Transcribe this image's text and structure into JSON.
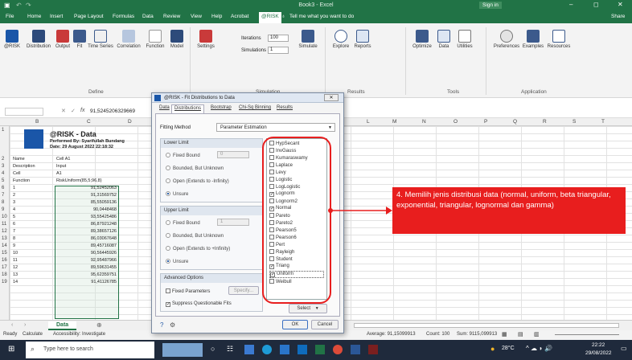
{
  "window": {
    "title": "Book3 - Excel",
    "sign_in": "Sign in",
    "share": "Share"
  },
  "menu": [
    "File",
    "Home",
    "Insert",
    "Page Layout",
    "Formulas",
    "Data",
    "Review",
    "View",
    "Help",
    "Acrobat",
    "@RISK"
  ],
  "tell_me": "Tell me what you want to do",
  "ribbon": {
    "buttons": [
      "@RISK",
      "Distribution",
      "Output",
      "Fit",
      "Time Series",
      "Correlation",
      "Function",
      "Model",
      "Settings",
      "Simulate",
      "Explore",
      "Reports",
      "Optimize",
      "Data",
      "Utilities",
      "Preferences",
      "Examples",
      "Resources"
    ],
    "iterations_label": "Iterations",
    "iterations_value": "100",
    "simulations_label": "Simulations",
    "simulations_value": "1",
    "groups": [
      "Define",
      "Simulation",
      "Results",
      "Tools",
      "Application"
    ]
  },
  "formula_bar": {
    "value": "91,5245206329669"
  },
  "columns": [
    "B",
    "C",
    "D",
    "L",
    "M",
    "N",
    "O",
    "P",
    "Q",
    "R",
    "S",
    "T"
  ],
  "rows": [
    "1",
    "2",
    "3",
    "4",
    "5",
    "6",
    "7",
    "8",
    "9",
    "10",
    "11",
    "12",
    "13",
    "14",
    "15",
    "16",
    "17",
    "18",
    "19"
  ],
  "report": {
    "title": "@RISK - Data",
    "performed_by": "Performed By: Syarifullah Bundang",
    "date": "Date: 29 August 2022 22:18:32",
    "rows": [
      {
        "label": "Name",
        "value": "Cell A1"
      },
      {
        "label": "Description",
        "value": "Input"
      },
      {
        "label": "Cell",
        "value": "A1"
      },
      {
        "label": "Function",
        "value": "RiskUniform(85,5;96,8)"
      }
    ],
    "index": [
      "1",
      "2",
      "3",
      "4",
      "5",
      "6",
      "7",
      "8",
      "9",
      "10",
      "11",
      "12",
      "13",
      "14"
    ],
    "values": [
      "91,52452063",
      "91,31569752",
      "85,55059136",
      "90,0448468",
      "93,55425486",
      "86,87921248",
      "89,38657126",
      "86,03067648",
      "89,45716087",
      "90,56445926",
      "92,95487966",
      "89,59631455",
      "95,62359751",
      "91,41126785"
    ]
  },
  "dialog": {
    "title": "@RISK - Fit Distributions to Data",
    "tabs": [
      "Data",
      "Distributions",
      "Bootstrap",
      "Chi-Sq Binning",
      "Results"
    ],
    "fitting_method_label": "Fitting Method",
    "fitting_method_value": "Parameter Estimation",
    "lower_limit": {
      "header": "Lower Limit",
      "options": [
        "Fixed Bound",
        "Bounded, But Unknown",
        "Open (Extends to -Infinity)",
        "Unsure"
      ],
      "fixed_value": "0"
    },
    "upper_limit": {
      "header": "Upper Limit",
      "options": [
        "Fixed Bound",
        "Bounded, But Unknown",
        "Open (Extends to +Infinity)",
        "Unsure"
      ],
      "fixed_value": "1"
    },
    "advanced": {
      "header": "Advanced Options",
      "fixed_parameters": "Fixed Parameters",
      "specify": "Specify...",
      "suppress": "Suppress Questionable Fits"
    },
    "distributions": [
      {
        "name": "HypSecant",
        "checked": false
      },
      {
        "name": "InvGauss",
        "checked": false
      },
      {
        "name": "Kumaraswamy",
        "checked": false
      },
      {
        "name": "Laplace",
        "checked": false
      },
      {
        "name": "Levy",
        "checked": false
      },
      {
        "name": "Logistic",
        "checked": false
      },
      {
        "name": "LogLogistic",
        "checked": false
      },
      {
        "name": "Lognorm",
        "checked": true
      },
      {
        "name": "Lognorm2",
        "checked": false
      },
      {
        "name": "Normal",
        "checked": true
      },
      {
        "name": "Pareto",
        "checked": false
      },
      {
        "name": "Pareto2",
        "checked": false
      },
      {
        "name": "Pearson5",
        "checked": false
      },
      {
        "name": "Pearson6",
        "checked": false
      },
      {
        "name": "Pert",
        "checked": false
      },
      {
        "name": "Rayleigh",
        "checked": false
      },
      {
        "name": "Student",
        "checked": false
      },
      {
        "name": "Triang",
        "checked": true
      },
      {
        "name": "Uniform",
        "checked": true
      },
      {
        "name": "Weibull",
        "checked": false
      }
    ],
    "select": "Select",
    "ok": "OK",
    "cancel": "Cancel"
  },
  "annotation": {
    "text": "4. Memilih jenis distribusi data (normal, uniform, beta triangular, exponential, triangular, lognormal dan gamma)"
  },
  "sheet_tab": "Data",
  "status": {
    "ready": "Ready",
    "calculate": "Calculate",
    "accessibility": "Accessibility: Investigate",
    "average": "Average: 91,15099913",
    "count": "Count: 100",
    "sum": "Sum: 9115,099913"
  },
  "taskbar": {
    "search": "Type here to search",
    "weather": "28°C",
    "time": "22:22",
    "date": "29/08/2022"
  },
  "colors": {
    "excel_green": "#217346",
    "annotation_red": "#e81e1e",
    "dialog_blue": "#2b5fa8"
  }
}
